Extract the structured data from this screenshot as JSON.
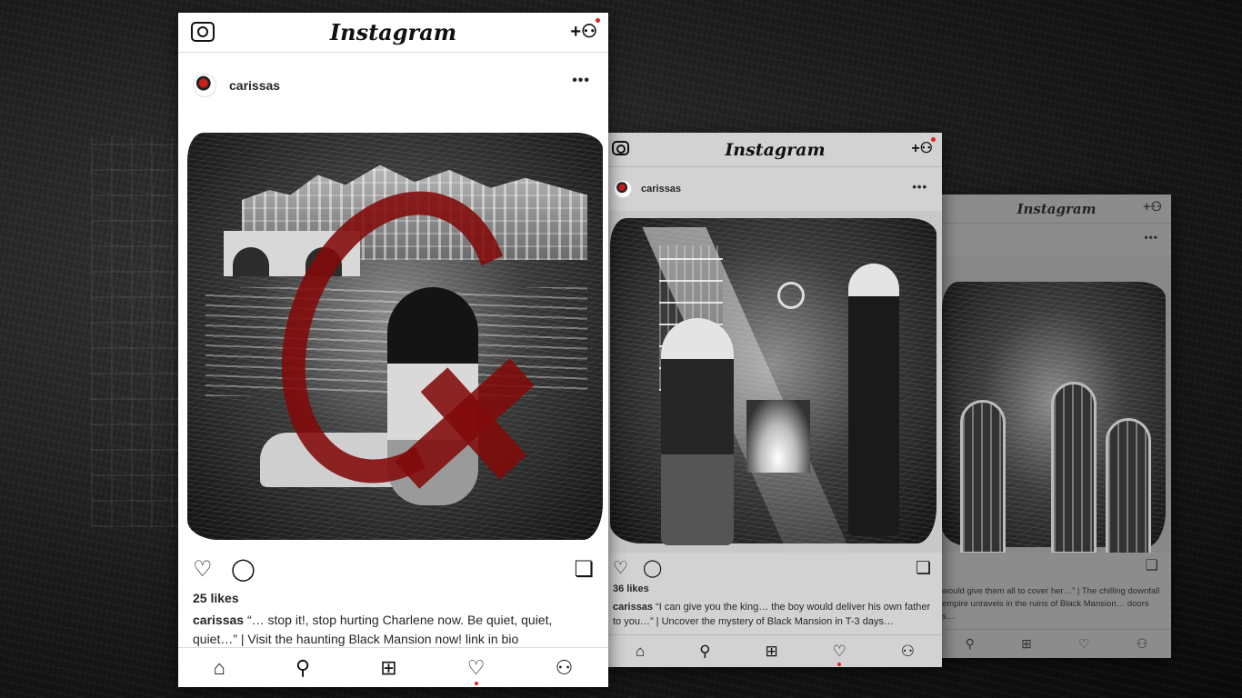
{
  "colors": {
    "accent_red": "#e0202a",
    "paint_red": "#820a0a",
    "card_white": "#ffffff",
    "text_dark": "#262626"
  },
  "cards": [
    {
      "app_title": "Instagram",
      "username": "carissas",
      "likes": "25 likes",
      "caption_user": "carissas",
      "caption_text": " “… stop it!, stop hurting Charlene now. Be quiet, quiet, quiet…” | Visit the haunting Black Mansion now! link in bio",
      "icons": [
        "camera-icon",
        "add-user-icon",
        "more-icon",
        "heart-icon",
        "comment-icon",
        "bookmark-icon",
        "home-icon",
        "search-icon",
        "add-post-icon",
        "activity-heart-icon",
        "profile-icon"
      ]
    },
    {
      "app_title": "Instagram",
      "username": "carissas",
      "likes": "36 likes",
      "caption_user": "carissas",
      "caption_text": " “I can give you the king… the boy would deliver his own father to you…” |  Uncover the mystery of Black Mansion in  T-3 days…",
      "icons": [
        "camera-icon",
        "add-user-icon",
        "more-icon",
        "heart-icon",
        "comment-icon",
        "bookmark-icon",
        "home-icon",
        "search-icon",
        "add-post-icon",
        "activity-heart-icon",
        "profile-icon"
      ]
    },
    {
      "app_title": "Instagram",
      "caption_line1": "would give them all to cover her…”  |  The chilling downfall",
      "caption_line2": "empire unravels in the ruins of Black Mansion… doors",
      "caption_line3": "s…",
      "icons": [
        "add-user-icon",
        "more-icon",
        "bookmark-icon",
        "search-icon",
        "add-post-icon",
        "activity-heart-icon",
        "profile-icon"
      ]
    }
  ],
  "glyphs": {
    "add_user": "+👤",
    "more": "•••",
    "heart": "♡",
    "comment": "◯",
    "bookmark": "🔖",
    "home": "⌂",
    "search": "⚲",
    "add_post": "⊞",
    "profile": "⚇"
  }
}
